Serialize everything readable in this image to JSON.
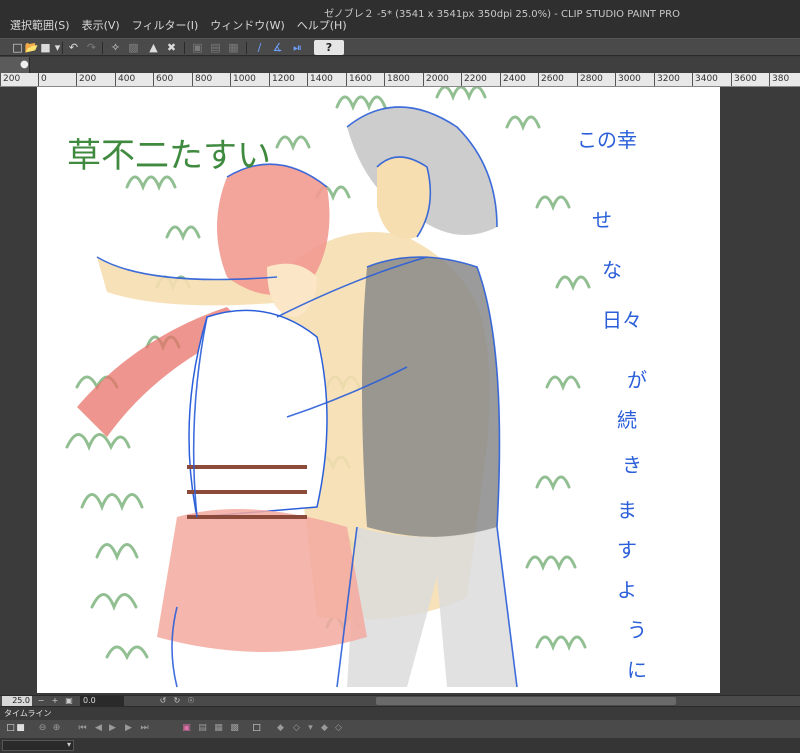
{
  "window": {
    "title": "ゼノブレ２ -5* (3541 x 3541px 350dpi 25.0%)  - CLIP STUDIO PAINT PRO"
  },
  "menu": {
    "items": [
      {
        "label": "選択範囲(S)"
      },
      {
        "label": "表示(V)"
      },
      {
        "label": "フィルター(I)"
      },
      {
        "label": "ウィンドウ(W)"
      },
      {
        "label": "ヘルプ(H)"
      }
    ]
  },
  "toolbar": {
    "help_label": "?",
    "icons": [
      "new-canvas-icon",
      "open-file-icon",
      "save-icon",
      "undo-icon",
      "redo-icon",
      "transform-icon",
      "clear-icon",
      "fill-icon",
      "select-icon",
      "snap-icon",
      "ruler-icon"
    ]
  },
  "ruler": {
    "labels": [
      "200",
      "0",
      "200",
      "400",
      "600",
      "800",
      "1000",
      "1200",
      "1400",
      "1600",
      "1800",
      "2000",
      "2200",
      "2400",
      "2600",
      "2800",
      "3000",
      "3200",
      "3400",
      "3600",
      "380"
    ]
  },
  "artwork": {
    "text_left": "草不二たすい",
    "text_right_lines": [
      "この幸",
      "せ",
      "な",
      "日々",
      "が",
      "続",
      "き",
      "ま",
      "す",
      "よ",
      "う",
      "に"
    ]
  },
  "status": {
    "zoom": "25.0",
    "angle": "0.0"
  },
  "timeline": {
    "title": "タイムライン"
  },
  "colors": {
    "menubar": "#2f2f2f",
    "toolbar": "#4a4a4a",
    "workarea": "#3b3b3b",
    "canvas": "#ffffff",
    "sketch_blue": "#2b5fd9",
    "grass_green": "#6aa86a",
    "hair_red": "#e8716a",
    "skin": "#f6deb0",
    "shirt_gray": "#8a8a8a"
  }
}
